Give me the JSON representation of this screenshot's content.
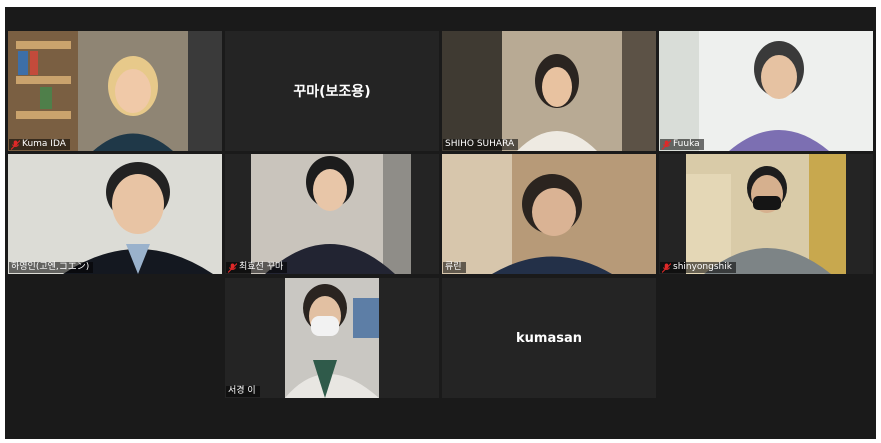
{
  "participants": [
    {
      "name": "Kuma IDA",
      "muted": true
    },
    {
      "name": "꾸마(보조용)",
      "muted": false
    },
    {
      "name": "SHIHO SUHARA",
      "muted": false
    },
    {
      "name": "Fuuka",
      "muted": true
    },
    {
      "name": "하영인(고엔,コエン)",
      "muted": false,
      "active_speaker": true
    },
    {
      "name": "최효선 꾸마",
      "muted": true
    },
    {
      "name": "류린",
      "muted": false
    },
    {
      "name": "shinyongshik",
      "muted": true
    },
    {
      "name": "서경 이",
      "muted": false
    },
    {
      "name": "kumasan",
      "muted": false
    }
  ],
  "colors": {
    "background": "#1a1a1a",
    "tile": "#242424",
    "active_border": "#e3ee86",
    "muted_icon": "#e02828"
  }
}
